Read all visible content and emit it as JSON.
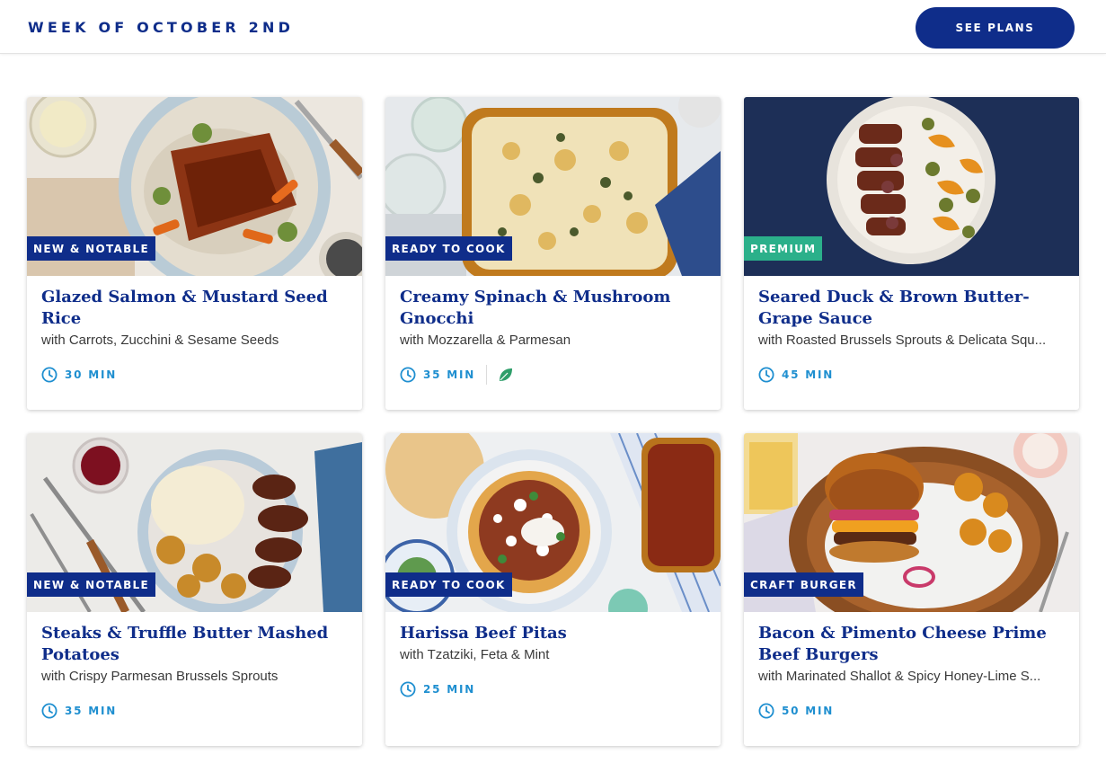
{
  "header": {
    "week_title": "WEEK OF OCTOBER 2ND",
    "see_plans_label": "SEE PLANS"
  },
  "colors": {
    "brand_blue": "#0f2d8a",
    "time_blue": "#1f8fd0",
    "premium_green": "#2bb08a",
    "veg_green": "#2e9e6a"
  },
  "recipes": [
    {
      "tag": "NEW & NOTABLE",
      "tag_color": "#0f2d8a",
      "title": "Glazed Salmon & Mustard Seed Rice",
      "subtitle": "with Carrots, Zucchini & Sesame Seeds",
      "time": "30 MIN",
      "icon": "clock-icon"
    },
    {
      "tag": "READY TO COOK",
      "tag_color": "#0f2d8a",
      "title": "Creamy Spinach & Mushroom Gnocchi",
      "subtitle": "with Mozzarella & Parmesan",
      "time": "35 MIN",
      "icon": "clock-icon",
      "badge_icon": "leaf-icon"
    },
    {
      "tag": "PREMIUM",
      "tag_color": "#2bb08a",
      "title": "Seared Duck & Brown Butter-Grape Sauce",
      "subtitle": "with Roasted Brussels Sprouts & Delicata Squ...",
      "time": "45 MIN",
      "icon": "clock-icon"
    },
    {
      "tag": "NEW & NOTABLE",
      "tag_color": "#0f2d8a",
      "title": "Steaks & Truffle Butter Mashed Potatoes",
      "subtitle": "with Crispy Parmesan Brussels Sprouts",
      "time": "35 MIN",
      "icon": "clock-icon"
    },
    {
      "tag": "READY TO COOK",
      "tag_color": "#0f2d8a",
      "title": "Harissa Beef Pitas",
      "subtitle": "with Tzatziki, Feta & Mint",
      "time": "25 MIN",
      "icon": "clock-icon"
    },
    {
      "tag": "CRAFT BURGER",
      "tag_color": "#0f2d8a",
      "title": "Bacon & Pimento Cheese Prime Beef Burgers",
      "subtitle": "with Marinated Shallot & Spicy Honey-Lime S...",
      "time": "50 MIN",
      "icon": "clock-icon"
    }
  ]
}
